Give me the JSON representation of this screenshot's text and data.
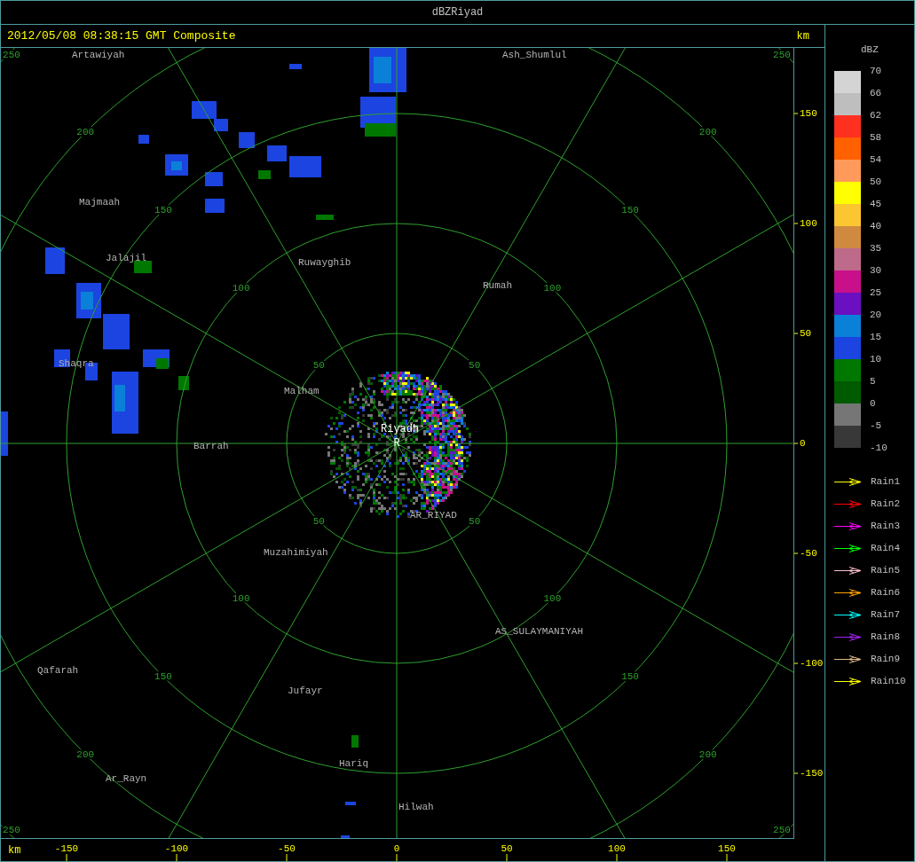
{
  "window": {
    "title": "dBZRiyad"
  },
  "header": {
    "timestamp": "2012/05/08 08:38:15 GMT Composite",
    "unit": "km"
  },
  "range_rings": [
    {
      "labels": [
        "50",
        "50",
        "50",
        "50"
      ]
    },
    {
      "labels": [
        "100",
        "100",
        "100",
        "100"
      ]
    },
    {
      "labels": [
        "150",
        "150",
        "150",
        "150"
      ]
    },
    {
      "labels": [
        "200",
        "200",
        "200",
        "200"
      ]
    },
    {
      "labels": [
        "250",
        "250",
        "250",
        "250"
      ]
    }
  ],
  "places": [
    {
      "name": "Artawiyah",
      "kind": "city"
    },
    {
      "name": "Ash_Shumlul",
      "kind": "city"
    },
    {
      "name": "Majmaah",
      "kind": "city"
    },
    {
      "name": "Jalajil",
      "kind": "city"
    },
    {
      "name": "Ruwayghib",
      "kind": "city"
    },
    {
      "name": "Rumah",
      "kind": "city"
    },
    {
      "name": "Shaqra",
      "kind": "city"
    },
    {
      "name": "Malham",
      "kind": "city"
    },
    {
      "name": "Barrah",
      "kind": "city"
    },
    {
      "name": "Riyadh",
      "kind": "site"
    },
    {
      "name": "R",
      "kind": "site"
    },
    {
      "name": "AR_RIYAD",
      "kind": "city"
    },
    {
      "name": "Muzahimiyah",
      "kind": "city"
    },
    {
      "name": "AS_SULAYMANIYAH",
      "kind": "city"
    },
    {
      "name": "Qafarah",
      "kind": "city"
    },
    {
      "name": "Jufayr",
      "kind": "city"
    },
    {
      "name": "Hariq",
      "kind": "city"
    },
    {
      "name": "Ar_Rayn",
      "kind": "city"
    },
    {
      "name": "Hilwah",
      "kind": "city"
    }
  ],
  "y_axis": {
    "ticks": [
      "150",
      "100",
      "50",
      "0",
      "-50",
      "-100",
      "-150"
    ]
  },
  "x_axis": {
    "unit": "km",
    "ticks": [
      "-150",
      "-100",
      "-50",
      "0",
      "50",
      "100",
      "150"
    ]
  },
  "color_scale": {
    "title": "dBZ",
    "bins": [
      {
        "color": "#d4d4d4"
      },
      {
        "color": "#bebebe"
      },
      {
        "color": "#ff3020"
      },
      {
        "color": "#ff6000"
      },
      {
        "color": "#ff9a5a"
      },
      {
        "color": "#ffff00"
      },
      {
        "color": "#fcc630"
      },
      {
        "color": "#d08a40"
      },
      {
        "color": "#be6a8a"
      },
      {
        "color": "#c8108a"
      },
      {
        "color": "#6a10c0"
      },
      {
        "color": "#0a80d8"
      },
      {
        "color": "#1c44e0"
      },
      {
        "color": "#007800"
      },
      {
        "color": "#005a00"
      },
      {
        "color": "#767676"
      },
      {
        "color": "#383838"
      }
    ],
    "labels": [
      "70",
      "66",
      "62",
      "58",
      "54",
      "50",
      "45",
      "40",
      "35",
      "30",
      "25",
      "20",
      "15",
      "10",
      "5",
      "0",
      "-5",
      "-10"
    ]
  },
  "rain_legend": [
    {
      "label": "Rain1",
      "color": "#ffff00"
    },
    {
      "label": "Rain2",
      "color": "#ff0000"
    },
    {
      "label": "Rain3",
      "color": "#ff00ff"
    },
    {
      "label": "Rain4",
      "color": "#00ff00"
    },
    {
      "label": "Rain5",
      "color": "#ffc0cb"
    },
    {
      "label": "Rain6",
      "color": "#ffa500"
    },
    {
      "label": "Rain7",
      "color": "#00ffff"
    },
    {
      "label": "Rain8",
      "color": "#a020f0"
    },
    {
      "label": "Rain9",
      "color": "#deb887"
    },
    {
      "label": "Rain10",
      "color": "#ffff00"
    }
  ]
}
